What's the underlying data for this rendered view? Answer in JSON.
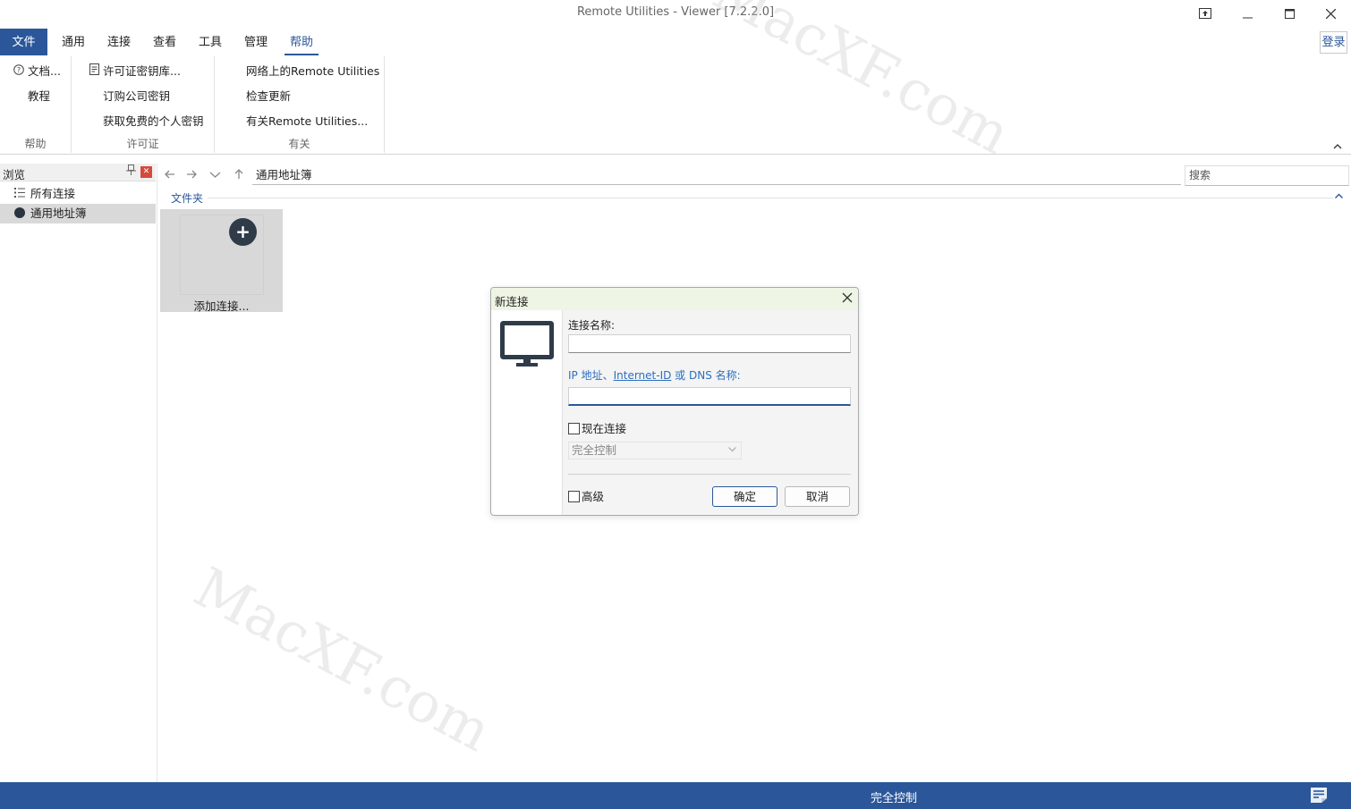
{
  "window": {
    "title": "Remote Utilities - Viewer [7.2.2.0]"
  },
  "ribbon": {
    "file_tab": "文件",
    "tabs": [
      "通用",
      "连接",
      "查看",
      "工具",
      "管理",
      "帮助"
    ],
    "active_tab": "帮助",
    "login": "登录",
    "groups": {
      "help": {
        "label": "帮助",
        "items": [
          "文档...",
          "教程"
        ]
      },
      "license": {
        "label": "许可证",
        "items": [
          "许可证密钥库...",
          "订购公司密钥",
          "获取免费的个人密钥"
        ]
      },
      "about": {
        "label": "有关",
        "items": [
          "网络上的Remote Utilities",
          "检查更新",
          "有关Remote Utilities..."
        ]
      }
    }
  },
  "browse_pane": {
    "title": "浏览",
    "items": [
      "所有连接",
      "通用地址簿"
    ],
    "selected": "通用地址簿"
  },
  "navbar": {
    "address": "通用地址簿",
    "search_placeholder": "搜索"
  },
  "content": {
    "section": "文件夹",
    "tile_label": "添加连接..."
  },
  "dialog": {
    "title": "新连接",
    "name_label": "连接名称:",
    "name_value": "",
    "addr_label_prefix": "IP 地址、",
    "addr_label_link": "Internet-ID",
    "addr_label_suffix": " 或 DNS 名称:",
    "addr_value": "",
    "connect_now": "现在连接",
    "connect_now_checked": false,
    "mode": "完全控制",
    "advanced": "高级",
    "advanced_checked": false,
    "ok": "确定",
    "cancel": "取消"
  },
  "statusbar": {
    "text": "完全控制"
  },
  "watermarks": [
    "MacXF.com",
    "MacXF.com"
  ],
  "colors": {
    "accent": "#2b579a",
    "dialog_title_bg": "#eef5e4",
    "link": "#2b6fbf"
  }
}
